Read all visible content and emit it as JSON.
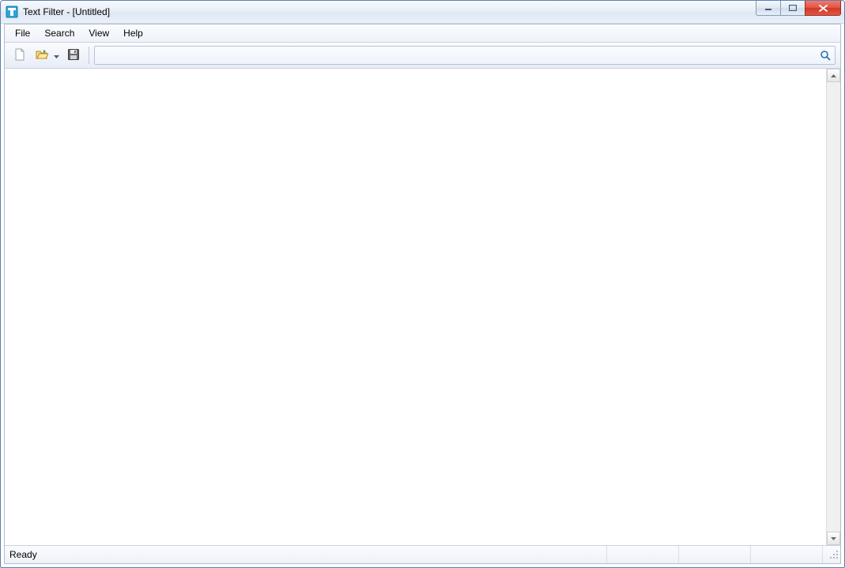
{
  "window": {
    "title": "Text Filter - [Untitled]"
  },
  "menu": {
    "items": [
      "File",
      "Search",
      "View",
      "Help"
    ]
  },
  "toolbar": {
    "new_tip": "New",
    "open_tip": "Open",
    "save_tip": "Save"
  },
  "search": {
    "value": "",
    "placeholder": ""
  },
  "content": {
    "text": ""
  },
  "status": {
    "main": "Ready",
    "pane1": "",
    "pane2": "",
    "pane3": ""
  }
}
